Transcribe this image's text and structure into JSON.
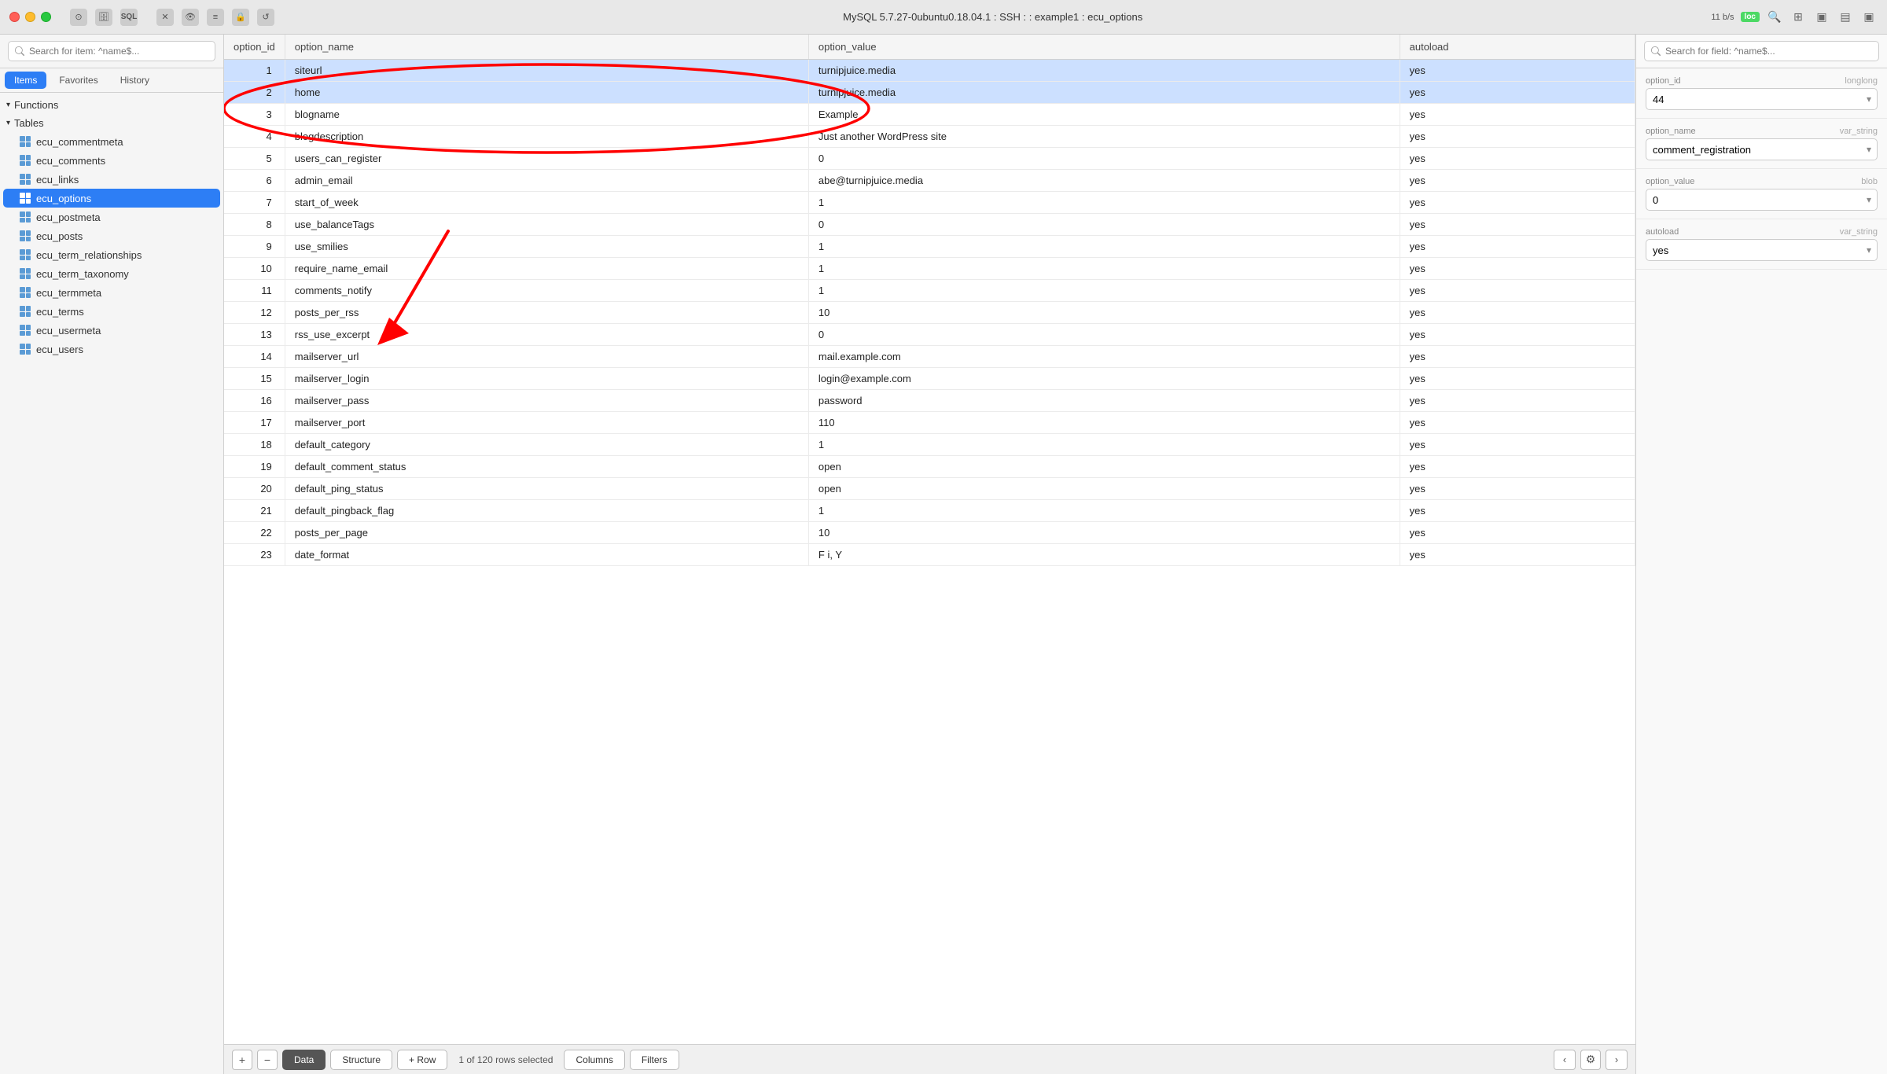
{
  "titlebar": {
    "title": "MySQL 5.7.27-0ubuntu0.18.04.1 : SSH :  : example1 : ecu_options",
    "speed": "11 b/s",
    "loc": "loc"
  },
  "sidebar": {
    "search_placeholder": "Search for item: ^name$...",
    "tabs": [
      {
        "label": "Items",
        "active": true
      },
      {
        "label": "Favorites",
        "active": false
      },
      {
        "label": "History",
        "active": false
      }
    ],
    "sections": [
      {
        "label": "Functions",
        "expanded": true,
        "items": []
      },
      {
        "label": "Tables",
        "expanded": true,
        "items": [
          {
            "label": "ecu_commentmeta",
            "active": false
          },
          {
            "label": "ecu_comments",
            "active": false
          },
          {
            "label": "ecu_links",
            "active": false
          },
          {
            "label": "ecu_options",
            "active": true
          },
          {
            "label": "ecu_postmeta",
            "active": false
          },
          {
            "label": "ecu_posts",
            "active": false
          },
          {
            "label": "ecu_term_relationships",
            "active": false
          },
          {
            "label": "ecu_term_taxonomy",
            "active": false
          },
          {
            "label": "ecu_termmeta",
            "active": false
          },
          {
            "label": "ecu_terms",
            "active": false
          },
          {
            "label": "ecu_usermeta",
            "active": false
          },
          {
            "label": "ecu_users",
            "active": false
          }
        ]
      }
    ]
  },
  "table": {
    "columns": [
      {
        "label": "option_id",
        "key": "option_id"
      },
      {
        "label": "option_name",
        "key": "option_name"
      },
      {
        "label": "option_value",
        "key": "option_value"
      },
      {
        "label": "autoload",
        "key": "autoload"
      }
    ],
    "rows": [
      {
        "id": 1,
        "option_id": "1",
        "option_name": "siteurl",
        "option_value": "turnipjuice.media",
        "autoload": "yes",
        "selected": true
      },
      {
        "id": 2,
        "option_id": "2",
        "option_name": "home",
        "option_value": "turnipjuice.media",
        "autoload": "yes",
        "selected": true
      },
      {
        "id": 3,
        "option_id": "3",
        "option_name": "blogname",
        "option_value": "Example",
        "autoload": "yes",
        "selected": false
      },
      {
        "id": 4,
        "option_id": "4",
        "option_name": "blogdescription",
        "option_value": "Just another WordPress site",
        "autoload": "yes",
        "selected": false
      },
      {
        "id": 5,
        "option_id": "5",
        "option_name": "users_can_register",
        "option_value": "0",
        "autoload": "yes",
        "selected": false
      },
      {
        "id": 6,
        "option_id": "6",
        "option_name": "admin_email",
        "option_value": "abe@turnipjuice.media",
        "autoload": "yes",
        "selected": false
      },
      {
        "id": 7,
        "option_id": "7",
        "option_name": "start_of_week",
        "option_value": "1",
        "autoload": "yes",
        "selected": false
      },
      {
        "id": 8,
        "option_id": "8",
        "option_name": "use_balanceTags",
        "option_value": "0",
        "autoload": "yes",
        "selected": false
      },
      {
        "id": 9,
        "option_id": "9",
        "option_name": "use_smilies",
        "option_value": "1",
        "autoload": "yes",
        "selected": false
      },
      {
        "id": 10,
        "option_id": "10",
        "option_name": "require_name_email",
        "option_value": "1",
        "autoload": "yes",
        "selected": false
      },
      {
        "id": 11,
        "option_id": "11",
        "option_name": "comments_notify",
        "option_value": "1",
        "autoload": "yes",
        "selected": false
      },
      {
        "id": 12,
        "option_id": "12",
        "option_name": "posts_per_rss",
        "option_value": "10",
        "autoload": "yes",
        "selected": false
      },
      {
        "id": 13,
        "option_id": "13",
        "option_name": "rss_use_excerpt",
        "option_value": "0",
        "autoload": "yes",
        "selected": false
      },
      {
        "id": 14,
        "option_id": "14",
        "option_name": "mailserver_url",
        "option_value": "mail.example.com",
        "autoload": "yes",
        "selected": false
      },
      {
        "id": 15,
        "option_id": "15",
        "option_name": "mailserver_login",
        "option_value": "login@example.com",
        "autoload": "yes",
        "selected": false
      },
      {
        "id": 16,
        "option_id": "16",
        "option_name": "mailserver_pass",
        "option_value": "password",
        "autoload": "yes",
        "selected": false
      },
      {
        "id": 17,
        "option_id": "17",
        "option_name": "mailserver_port",
        "option_value": "110",
        "autoload": "yes",
        "selected": false
      },
      {
        "id": 18,
        "option_id": "18",
        "option_name": "default_category",
        "option_value": "1",
        "autoload": "yes",
        "selected": false
      },
      {
        "id": 19,
        "option_id": "19",
        "option_name": "default_comment_status",
        "option_value": "open",
        "autoload": "yes",
        "selected": false
      },
      {
        "id": 20,
        "option_id": "20",
        "option_name": "default_ping_status",
        "option_value": "open",
        "autoload": "yes",
        "selected": false
      },
      {
        "id": 21,
        "option_id": "21",
        "option_name": "default_pingback_flag",
        "option_value": "1",
        "autoload": "yes",
        "selected": false
      },
      {
        "id": 22,
        "option_id": "22",
        "option_name": "posts_per_page",
        "option_value": "10",
        "autoload": "yes",
        "selected": false
      },
      {
        "id": 23,
        "option_id": "23",
        "option_name": "date_format",
        "option_value": "F i, Y",
        "autoload": "yes",
        "selected": false
      }
    ]
  },
  "bottom_bar": {
    "add_label": "+",
    "remove_label": "−",
    "data_label": "Data",
    "structure_label": "Structure",
    "add_row_label": "+ Row",
    "row_count": "1 of 120 rows selected",
    "columns_label": "Columns",
    "filters_label": "Filters"
  },
  "right_panel": {
    "search_placeholder": "Search for field: ^name$...",
    "fields": [
      {
        "label": "option_id",
        "type": "longlong",
        "value": "44"
      },
      {
        "label": "option_name",
        "type": "var_string",
        "value": "comment_registration"
      },
      {
        "label": "option_value",
        "type": "blob",
        "value": "0"
      },
      {
        "label": "autoload",
        "type": "var_string",
        "value": "yes"
      }
    ]
  }
}
